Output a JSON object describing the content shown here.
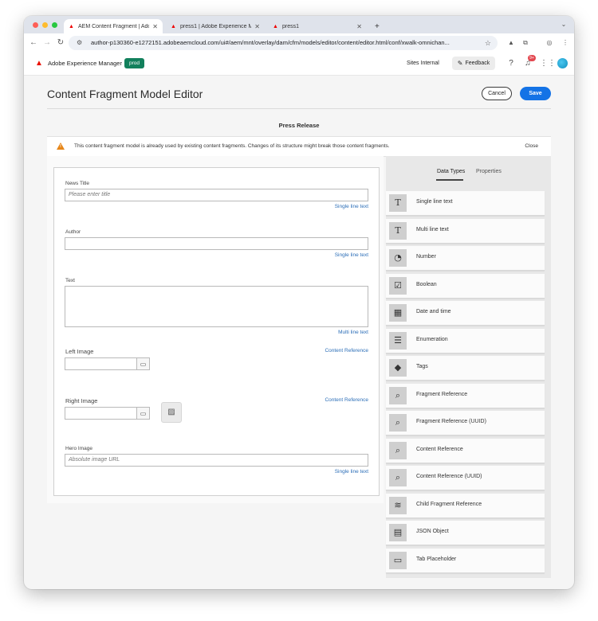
{
  "browser": {
    "tabs": [
      {
        "label": "AEM Content Fragment | Adobe",
        "close": "✕"
      },
      {
        "label": "press1 | Adobe Experience Ma",
        "close": "✕"
      },
      {
        "label": "press1",
        "close": "✕"
      }
    ],
    "new_tab": "+",
    "url": "author-p130360-e1272151.adobeaemcloud.com/ui#/aem/mnt/overlay/dam/cfm/models/editor/content/editor.html/conf/xwalk-omnichan..."
  },
  "header": {
    "app_name": "Adobe Experience Manager",
    "env_badge": "prod",
    "org": "Sites Internal",
    "feedback": "Feedback",
    "notifications_count": "9+"
  },
  "page": {
    "title": "Content Fragment Model Editor",
    "cancel_label": "Cancel",
    "save_label": "Save",
    "model_name": "Press Release"
  },
  "warning": {
    "text": "This content fragment model is already used by existing content fragments. Changes of its structure might break those content fragments.",
    "close_label": "Close"
  },
  "fields": {
    "news_title": {
      "label": "News Title",
      "placeholder": "Please enter title",
      "type": "Single line text"
    },
    "author": {
      "label": "Author",
      "type": "Single line text"
    },
    "text": {
      "label": "Text",
      "type": "Multi line text"
    },
    "left_image": {
      "label": "Left Image",
      "type": "Content Reference"
    },
    "right_image": {
      "label": "Right Image",
      "type": "Content Reference"
    },
    "hero_image": {
      "label": "Hero Image",
      "placeholder": "Absolute image URL",
      "type": "Single line text"
    }
  },
  "sidebar": {
    "tabs": [
      "Data Types",
      "Properties"
    ],
    "active_tab": "Data Types",
    "data_types": [
      {
        "label": "Single line text",
        "icon": "text-icon"
      },
      {
        "label": "Multi line text",
        "icon": "text-icon"
      },
      {
        "label": "Number",
        "icon": "gauge-icon"
      },
      {
        "label": "Boolean",
        "icon": "checkbox-icon"
      },
      {
        "label": "Date and time",
        "icon": "calendar-icon"
      },
      {
        "label": "Enumeration",
        "icon": "list-icon"
      },
      {
        "label": "Tags",
        "icon": "tag-icon"
      },
      {
        "label": "Fragment Reference",
        "icon": "folder-search-icon"
      },
      {
        "label": "Fragment Reference (UUID)",
        "icon": "folder-search-icon"
      },
      {
        "label": "Content Reference",
        "icon": "folder-search-icon"
      },
      {
        "label": "Content Reference (UUID)",
        "icon": "folder-search-icon"
      },
      {
        "label": "Child Fragment Reference",
        "icon": "layers-icon"
      },
      {
        "label": "JSON Object",
        "icon": "json-file-icon"
      },
      {
        "label": "Tab Placeholder",
        "icon": "window-icon"
      }
    ]
  },
  "colors": {
    "primary": "#1473e6",
    "prod_badge": "#12805c",
    "warning": "#e68619",
    "link": "#2d6fb8"
  }
}
